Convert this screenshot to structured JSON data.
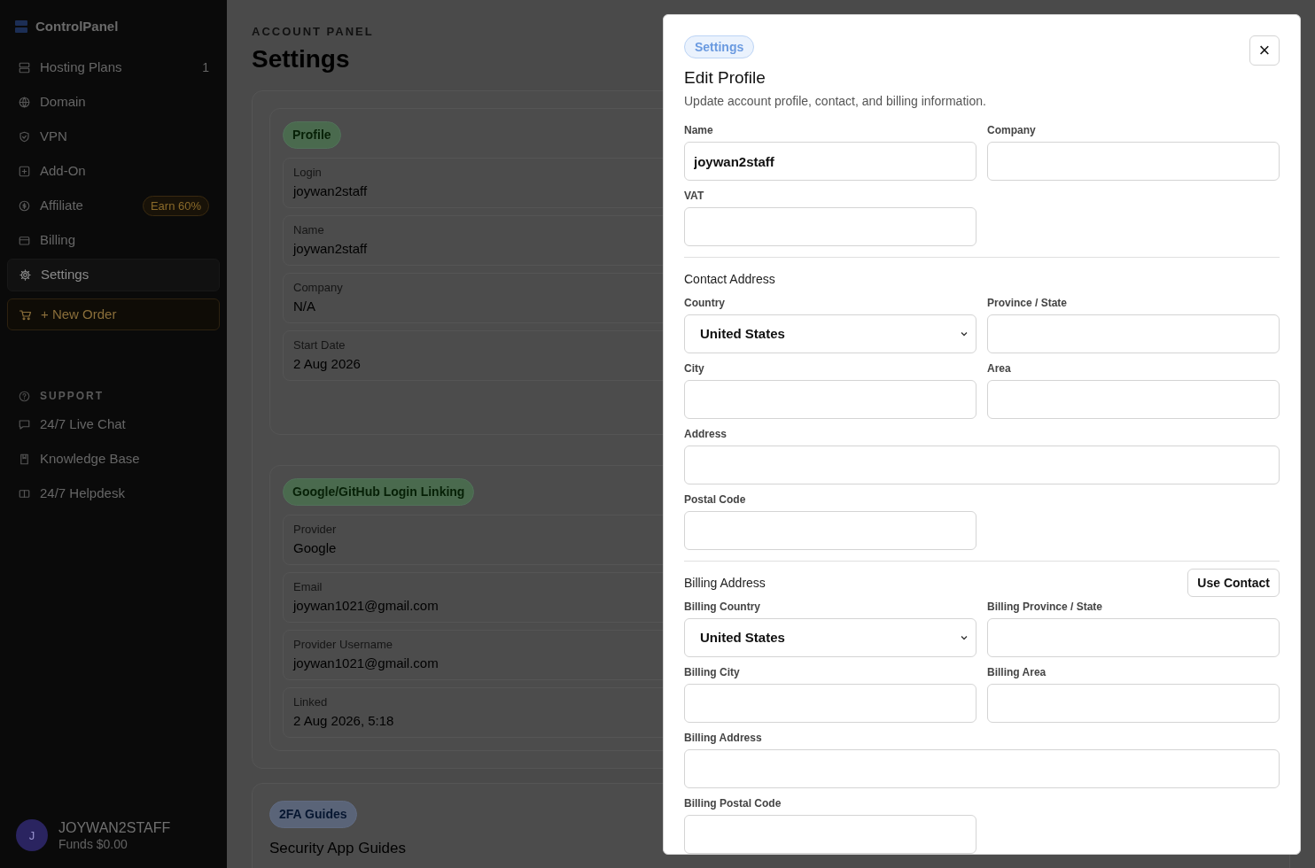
{
  "sidebar": {
    "brand": "ControlPanel",
    "items": [
      {
        "label": "Hosting Plans",
        "count": "1",
        "selected": false
      },
      {
        "label": "Domain",
        "selected": false
      },
      {
        "label": "VPN",
        "selected": false
      },
      {
        "label": "Add-On",
        "selected": false
      },
      {
        "label": "Affiliate",
        "badge": "Earn 60%",
        "selected": false
      },
      {
        "label": "Billing",
        "selected": false
      },
      {
        "label": "Settings",
        "selected": true
      }
    ],
    "new_order": "+ New Order",
    "support_heading": "SUPPORT",
    "support_items": [
      {
        "label": "24/7 Live Chat"
      },
      {
        "label": "Knowledge Base"
      },
      {
        "label": "24/7 Helpdesk"
      }
    ],
    "user": {
      "initial": "J",
      "name": "JOYWAN2STAFF",
      "funds": "Funds $0.00"
    }
  },
  "main": {
    "eyebrow": "ACCOUNT PANEL",
    "title": "Settings",
    "cards": [
      {
        "badge": "Profile",
        "fields": [
          {
            "label": "Login",
            "value": "joywan2staff"
          },
          {
            "label": "Name",
            "value": "joywan2staff"
          },
          {
            "label": "Company",
            "value": "N/A"
          },
          {
            "label": "Start Date",
            "value": "2 Aug 2026"
          }
        ]
      },
      {
        "badge": "Google/GitHub Login Linking",
        "fields": [
          {
            "label": "Provider",
            "value": "Google"
          },
          {
            "label": "Email",
            "value": "joywan1021@gmail.com"
          },
          {
            "label": "Provider Username",
            "value": "joywan1021@gmail.com"
          },
          {
            "label": "Linked",
            "value": "2 Aug 2026, 5:18"
          }
        ]
      }
    ],
    "guides": {
      "badge": "2FA Guides",
      "title": "Security App Guides"
    }
  },
  "modal": {
    "badge": "Settings",
    "title": "Edit Profile",
    "subtitle": "Update account profile, contact, and billing information.",
    "close": "×",
    "sections": [
      {
        "fields": [
          {
            "label": "Name",
            "kind": "text",
            "value": "joywan2staff"
          },
          {
            "label": "Company",
            "kind": "text"
          },
          {
            "label": "VAT",
            "kind": "text"
          }
        ]
      },
      {
        "heading": "Contact Address",
        "fields": [
          {
            "label": "Country",
            "kind": "select",
            "value": "United States"
          },
          {
            "label": "Province / State",
            "kind": "text"
          },
          {
            "label": "City",
            "kind": "text"
          },
          {
            "label": "Area",
            "kind": "text"
          },
          {
            "label": "Address",
            "kind": "wide-text"
          },
          {
            "label": "Postal Code",
            "kind": "text"
          }
        ]
      },
      {
        "heading": "Billing Address",
        "action": "Use Contact",
        "fields": [
          {
            "label": "Billing Country",
            "kind": "select",
            "value": "United States"
          },
          {
            "label": "Billing Province / State",
            "kind": "text"
          },
          {
            "label": "Billing City",
            "kind": "text"
          },
          {
            "label": "Billing Area",
            "kind": "text"
          },
          {
            "label": "Billing Address",
            "kind": "wide-text"
          },
          {
            "label": "Billing Postal Code",
            "kind": "text"
          }
        ]
      }
    ]
  }
}
